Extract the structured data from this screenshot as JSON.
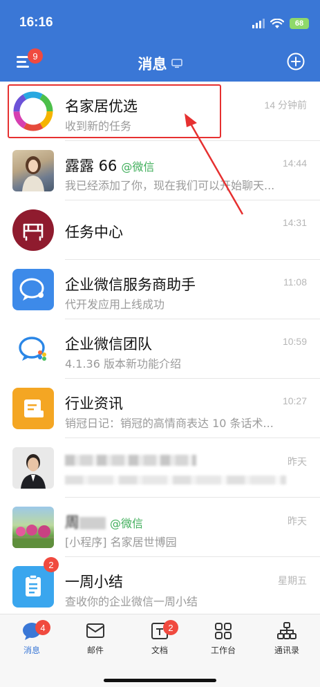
{
  "status_bar": {
    "time": "16:16",
    "battery": "68"
  },
  "header": {
    "title": "消息",
    "menu_badge": "9"
  },
  "conversations": [
    {
      "name": "名家居优选",
      "subtitle": "收到新的任务",
      "time": "14 分钟前"
    },
    {
      "name": "露露 66",
      "tag": "@微信",
      "subtitle": "我已经添加了你，现在我们可以开始聊天...",
      "time": "14:44"
    },
    {
      "name": "任务中心",
      "subtitle": "",
      "time": "14:31"
    },
    {
      "name": "企业微信服务商助手",
      "subtitle": "代开发应用上线成功",
      "time": "11:08"
    },
    {
      "name": "企业微信团队",
      "subtitle": "4.1.36 版本新功能介绍",
      "time": "10:59"
    },
    {
      "name": "行业资讯",
      "subtitle": "销冠日记：销冠的高情商表达 10 条话术...",
      "time": "10:27"
    },
    {
      "name": "",
      "subtitle": "",
      "time": "昨天"
    },
    {
      "name": "周",
      "tag": "@微信",
      "subtitle": "[小程序] 名家居世博园",
      "time": "昨天"
    },
    {
      "name": "一周小结",
      "subtitle": "查收你的企业微信一周小结",
      "time": "星期五",
      "badge": "2"
    }
  ],
  "tabs": [
    {
      "label": "消息",
      "badge": "4"
    },
    {
      "label": "邮件"
    },
    {
      "label": "文档",
      "badge": "2"
    },
    {
      "label": "工作台"
    },
    {
      "label": "通讯录"
    }
  ],
  "colors": {
    "header": "#3a77d6",
    "badge": "#f04a3f",
    "wechat_tag": "#3fae5a",
    "highlight": "#e63030"
  }
}
